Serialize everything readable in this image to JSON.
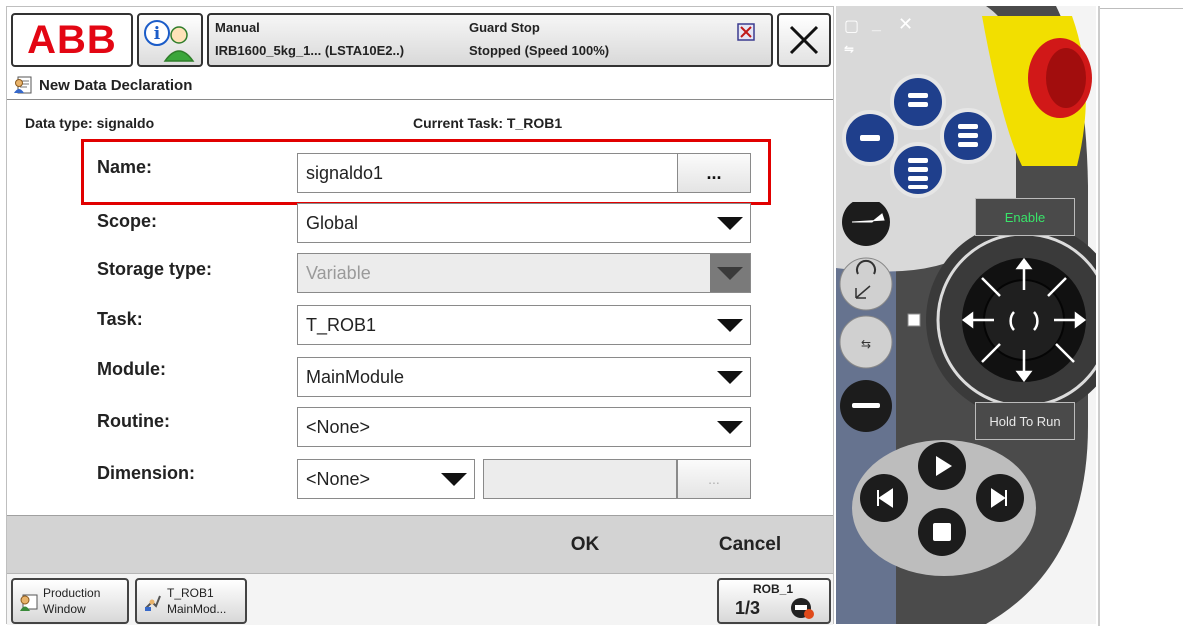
{
  "header": {
    "logo_text": "ABB",
    "mode": "Manual",
    "robot": "IRB1600_5kg_1... (LSTA10E2..)",
    "safety": "Guard Stop",
    "state": "Stopped (Speed 100%)"
  },
  "dialog": {
    "title": "New Data Declaration",
    "data_type": "Data type: signaldo",
    "current_task": "Current Task:  T_ROB1"
  },
  "form": {
    "name_label": "Name:",
    "name_value": "signaldo1",
    "name_browse": "...",
    "scope_label": "Scope:",
    "scope_value": "Global",
    "storage_label": "Storage type:",
    "storage_value": "Variable",
    "task_label": "Task:",
    "task_value": "T_ROB1",
    "module_label": "Module:",
    "module_value": "MainModule",
    "routine_label": "Routine:",
    "routine_value": "<None>",
    "dimension_label": "Dimension:",
    "dimension_value": "<None>",
    "dimension_browse": "..."
  },
  "commands": {
    "ok": "OK",
    "cancel": "Cancel"
  },
  "taskbar": {
    "production_line1": "Production",
    "production_line2": "Window",
    "task_line1": "T_ROB1",
    "task_line2": "MainMod...",
    "rob_label": "ROB_1",
    "rob_fraction": "1/3"
  },
  "hardware": {
    "enable_label": "Enable",
    "hold_to_run_label": "Hold To Run"
  },
  "colors": {
    "abb_red": "#e30613",
    "highlight_red": "#e10000",
    "pendant_body": "#4b4b4b",
    "pendant_buttons": "#1f3f8c",
    "estop_yellow": "#f2df00",
    "estop_red": "#d11818",
    "enable_text": "#39e46a"
  },
  "icons": {
    "info": "info-person-icon",
    "close": "close-x-icon",
    "dialog": "data-declaration-icon",
    "production": "production-window-icon",
    "task": "program-task-icon",
    "rob": "robot-status-icon"
  }
}
